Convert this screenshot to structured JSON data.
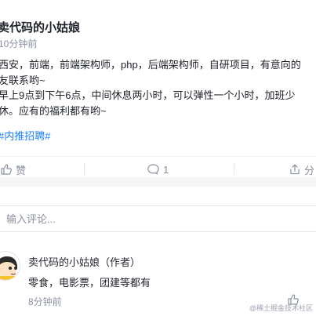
{
  "post": {
    "author": "卖代码的小姑娘",
    "time": "10分钟前",
    "lines": [
      "西安，前端，前端架构师，php，后端架构师，自研项目，有意向的",
      "友联系哟~",
      "早上9点到下午6点，中间休息两小时，可以弹性一个小时，加班少",
      "休。应有的福利都有哟~"
    ],
    "tag": "#内推招聘#"
  },
  "actions": {
    "like_label": "赞",
    "comment_count": "1",
    "share_label": "分"
  },
  "comment_input": {
    "placeholder": "输入评论..."
  },
  "comment": {
    "author": "卖代码的小姑娘（作者）",
    "text": "零食，电影票，团建等都有",
    "time": "8分钟前"
  },
  "watermark": "@稀土掘金技术社区",
  "colors": {
    "accent": "#1e80ff",
    "muted": "#8a919f",
    "text": "#1d2129"
  }
}
